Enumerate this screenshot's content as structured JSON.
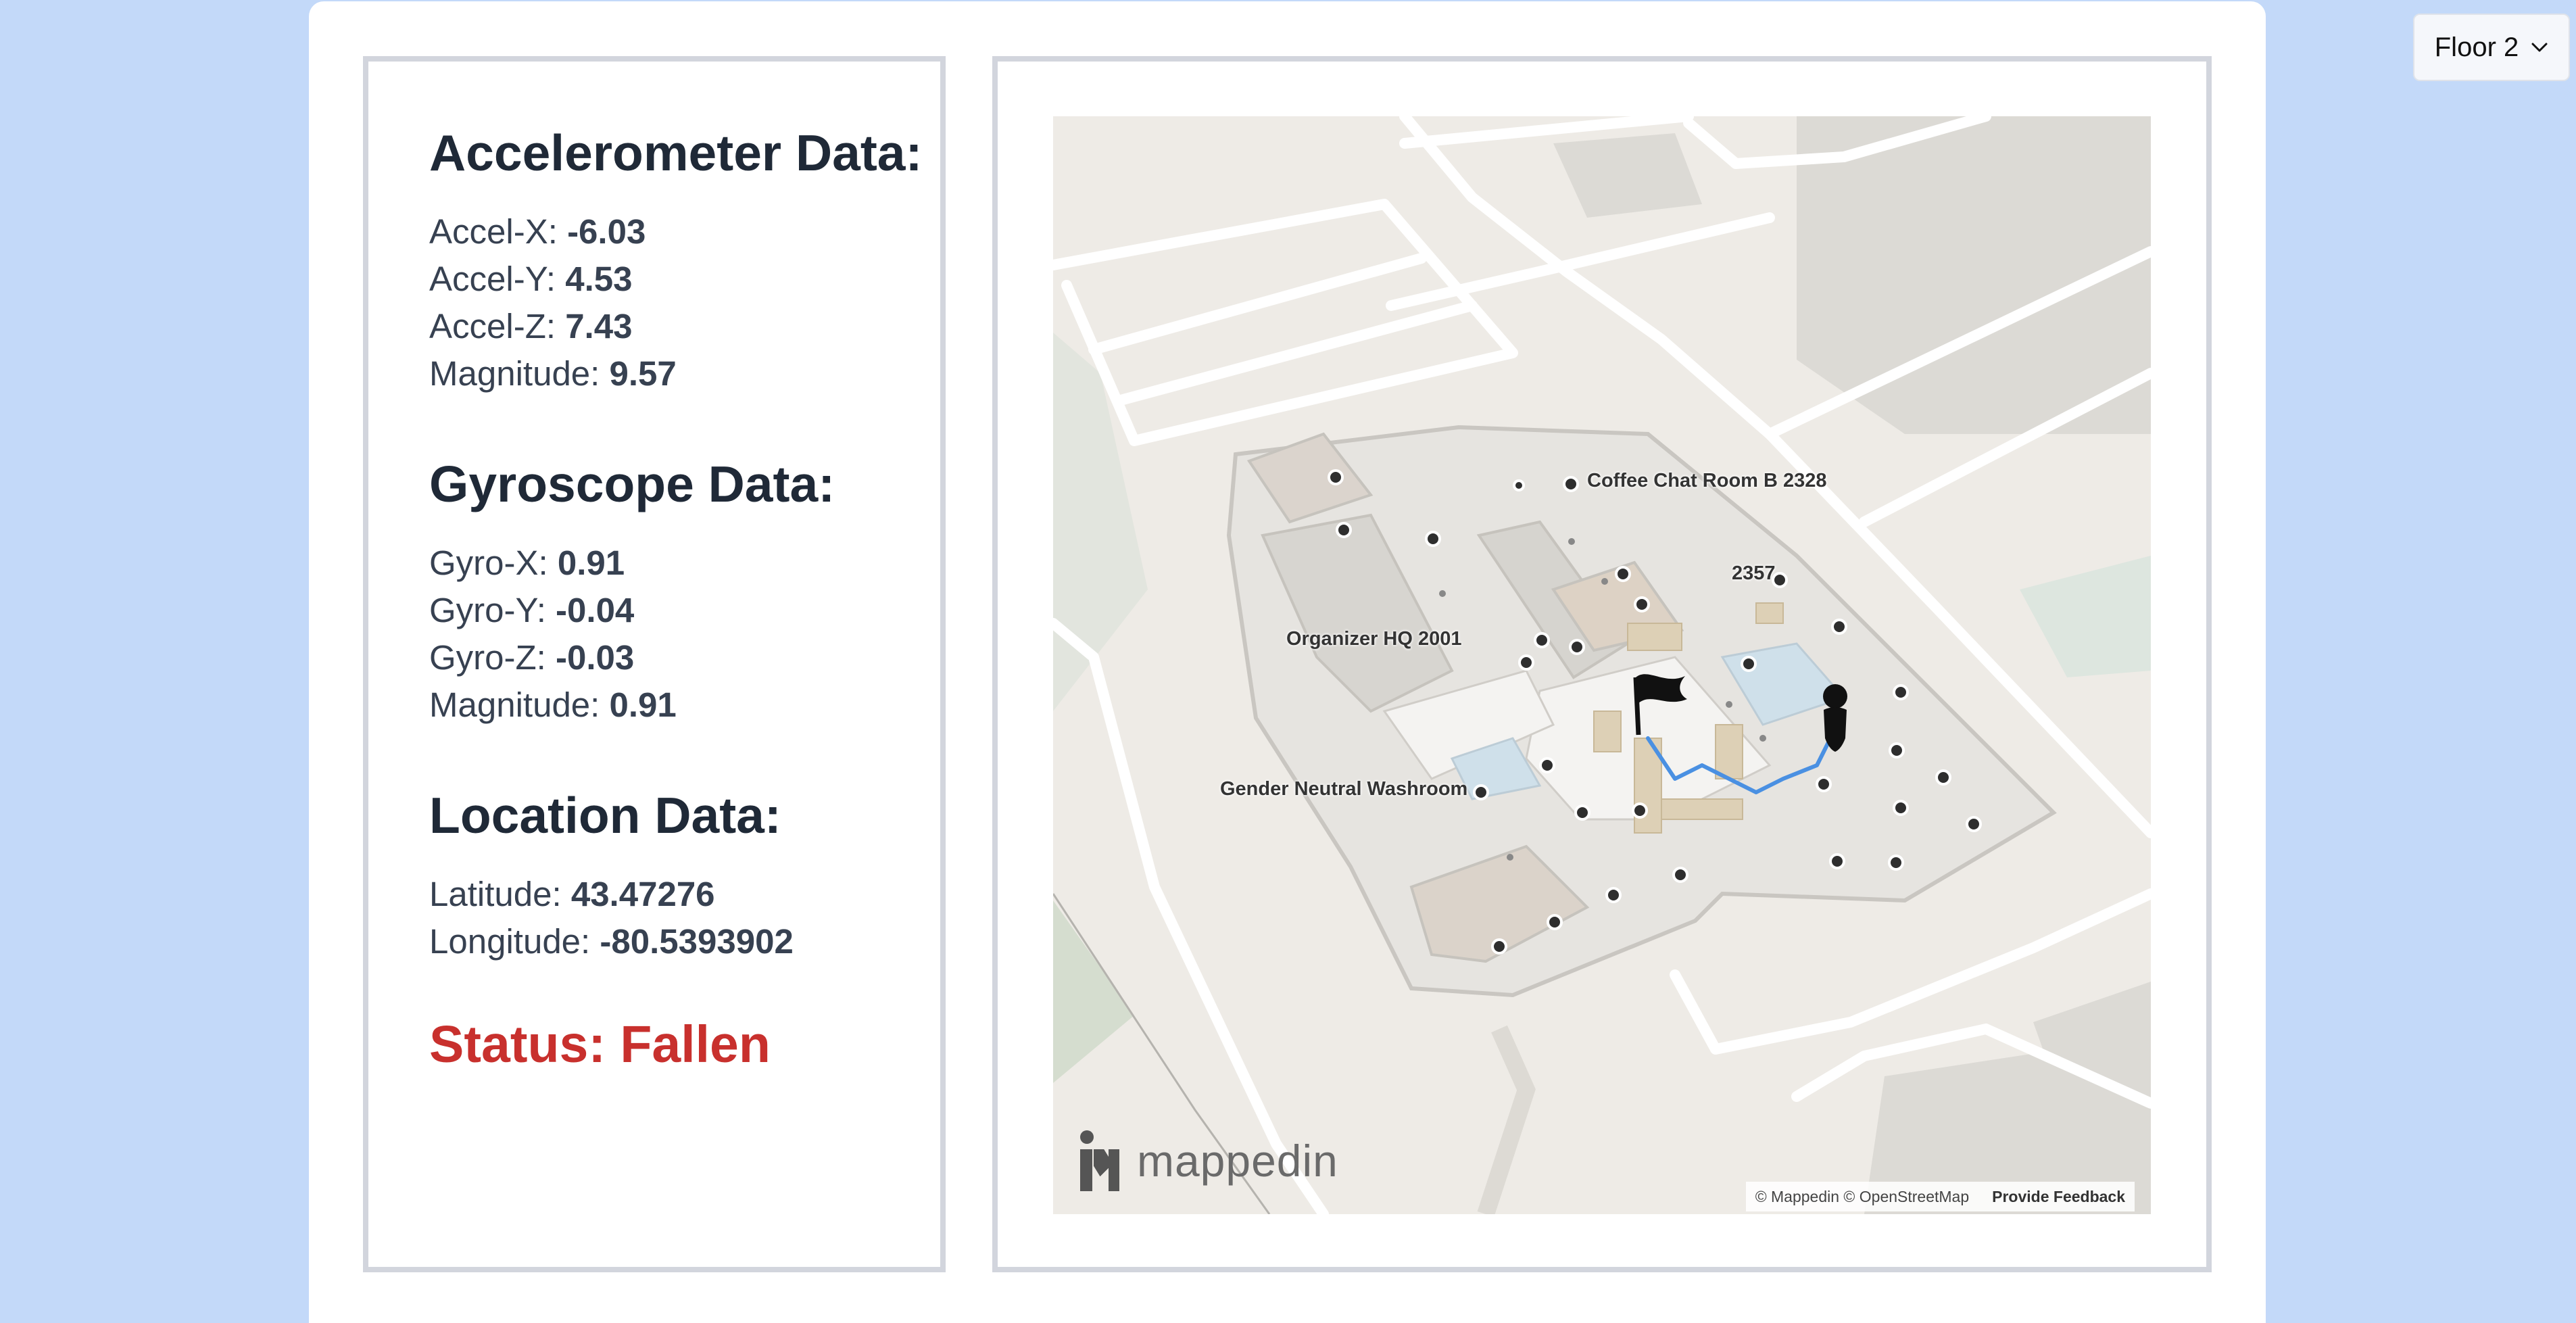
{
  "accelerometer": {
    "heading": "Accelerometer Data:",
    "x_label": "Accel-X: ",
    "x_value": "-6.03",
    "y_label": "Accel-Y: ",
    "y_value": "4.53",
    "z_label": "Accel-Z: ",
    "z_value": "7.43",
    "mag_label": "Magnitude: ",
    "mag_value": "9.57"
  },
  "gyroscope": {
    "heading": "Gyroscope Data:",
    "x_label": "Gyro-X: ",
    "x_value": "0.91",
    "y_label": "Gyro-Y: ",
    "y_value": "-0.04",
    "z_label": "Gyro-Z: ",
    "z_value": "-0.03",
    "mag_label": "Magnitude: ",
    "mag_value": "0.91"
  },
  "location": {
    "heading": "Location Data:",
    "lat_label": "Latitude: ",
    "lat_value": "43.47276",
    "lon_label": "Longitude: ",
    "lon_value": "-80.5393902"
  },
  "status": {
    "text": "Status: Fallen",
    "color": "#c8302d"
  },
  "map": {
    "labels": {
      "coffee_chat": "Coffee Chat Room B 2328",
      "room_2357": "2357",
      "organizer_hq": "Organizer HQ 2001",
      "washroom": "Gender Neutral Washroom"
    },
    "logo_text": "mappedin",
    "attribution": "© Mappedin © OpenStreetMap",
    "feedback": "Provide Feedback",
    "route_color": "#4a90e2"
  },
  "floor_select": {
    "value": "Floor 2",
    "icon": "chevron-down-icon"
  }
}
